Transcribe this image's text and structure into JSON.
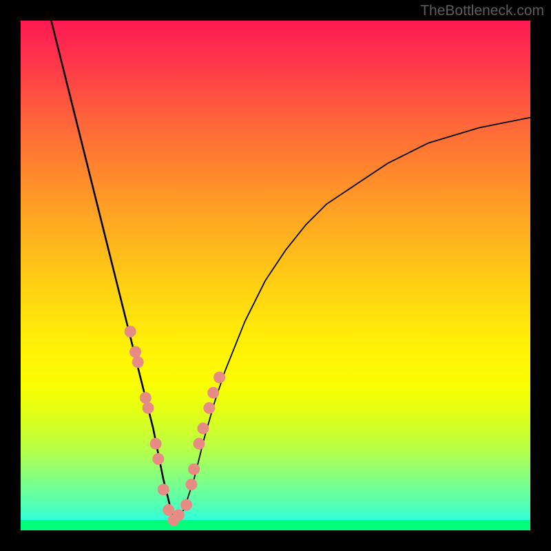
{
  "watermark": "TheBottleneck.com",
  "chart_data": {
    "type": "line",
    "title": "",
    "xlabel": "",
    "ylabel": "",
    "xlim": [
      0,
      100
    ],
    "ylim": [
      0,
      100
    ],
    "grid": false,
    "notes": "V-shaped bottleneck curve. Y-axis encoded by background gradient: red (top, ~100 = high bottleneck) through orange/yellow to green (bottom, ~0 = optimal). Minimum at roughly x=30, y≈2. Salmon markers cluster near the trough on both arms.",
    "series": [
      {
        "name": "bottleneck-curve",
        "color": "#000000",
        "x": [
          6,
          8,
          10,
          12,
          14,
          16,
          18,
          20,
          22,
          24,
          26,
          28,
          30,
          32,
          34,
          36,
          38,
          40,
          44,
          48,
          52,
          56,
          60,
          66,
          72,
          80,
          90,
          100
        ],
        "y": [
          100,
          92,
          84,
          76,
          68,
          60,
          52,
          44,
          36,
          28,
          20,
          10,
          2,
          4,
          10,
          18,
          25,
          31,
          41,
          49,
          55,
          60,
          64,
          68,
          72,
          76,
          79,
          81
        ]
      },
      {
        "name": "sample-points",
        "color": "#e78b85",
        "marker": "circle",
        "x": [
          21.5,
          22.5,
          23,
          24.5,
          25,
          26.5,
          27,
          28,
          29,
          30,
          31,
          32.5,
          33.5,
          34,
          35,
          35.8,
          37,
          37.8,
          39
        ],
        "y": [
          39,
          35,
          33,
          26,
          24,
          17,
          14,
          8,
          4,
          2,
          3,
          5,
          9,
          12,
          17,
          20,
          24,
          27,
          30
        ]
      }
    ]
  }
}
